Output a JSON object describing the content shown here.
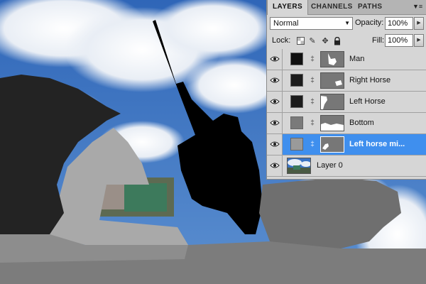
{
  "panel": {
    "tabs": [
      {
        "label": "LAYERS",
        "active": true
      },
      {
        "label": "CHANNELS",
        "active": false
      },
      {
        "label": "PATHS",
        "active": false
      }
    ],
    "blend_mode": "Normal",
    "opacity_label": "Opacity:",
    "opacity_value": "100%",
    "lock_label": "Lock:",
    "fill_label": "Fill:",
    "fill_value": "100%",
    "layers": [
      {
        "name": "Man",
        "selected": false,
        "visible": true,
        "swatch_color": "#111111"
      },
      {
        "name": "Right Horse",
        "selected": false,
        "visible": true,
        "swatch_color": "#1c1c1c"
      },
      {
        "name": "Left Horse",
        "selected": false,
        "visible": true,
        "swatch_color": "#1c1c1c"
      },
      {
        "name": "Bottom",
        "selected": false,
        "visible": true,
        "swatch_color": "#7a7a7a"
      },
      {
        "name": "Left horse mi...",
        "selected": true,
        "visible": true,
        "swatch_color": "#9a9a9a"
      },
      {
        "name": "Layer 0",
        "selected": false,
        "visible": true
      }
    ]
  },
  "colors": {
    "selection": "#3f8fee",
    "panel_bg": "#d6d6d6",
    "sky": "#3a73c4"
  },
  "icons": {
    "panel_menu": "panel-menu-icon",
    "lock_transparent": "lock-transparent-pixels-icon",
    "lock_image": "lock-image-pixels-icon",
    "lock_position": "lock-position-icon",
    "lock_all": "lock-all-icon",
    "visibility": "eye-icon",
    "link": "chain-link-icon"
  }
}
